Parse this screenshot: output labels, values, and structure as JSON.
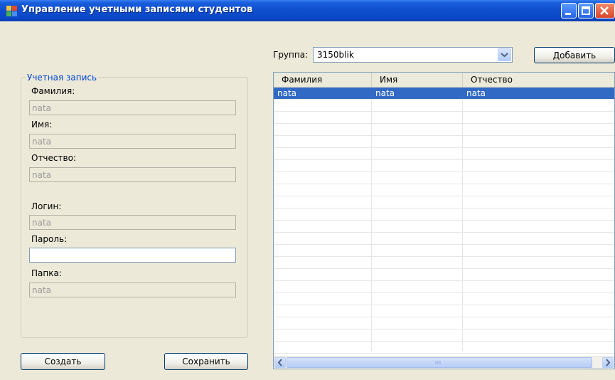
{
  "window": {
    "title": "Управление учетными записями студентов"
  },
  "account": {
    "group_title": "Учетная запись",
    "last_name_label": "Фамилия:",
    "last_name_value": "nata",
    "first_name_label": "Имя:",
    "first_name_value": "nata",
    "middle_name_label": "Отчество:",
    "middle_name_value": "nata",
    "login_label": "Логин:",
    "login_value": "nata",
    "password_label": "Пароль:",
    "password_value": "",
    "folder_label": "Папка:",
    "folder_value": "nata"
  },
  "buttons": {
    "create": "Создать",
    "save": "Сохранить",
    "add": "Добавить"
  },
  "group_selector": {
    "label": "Группа:",
    "value": "3150blik"
  },
  "table": {
    "columns": [
      "Фамилия",
      "Имя",
      "Отчество"
    ],
    "rows": [
      [
        "nata",
        "nata",
        "nata"
      ]
    ]
  },
  "colors": {
    "titlebar": "#0F4FD0",
    "selection": "#316AC5",
    "group_title": "#0046D5"
  }
}
